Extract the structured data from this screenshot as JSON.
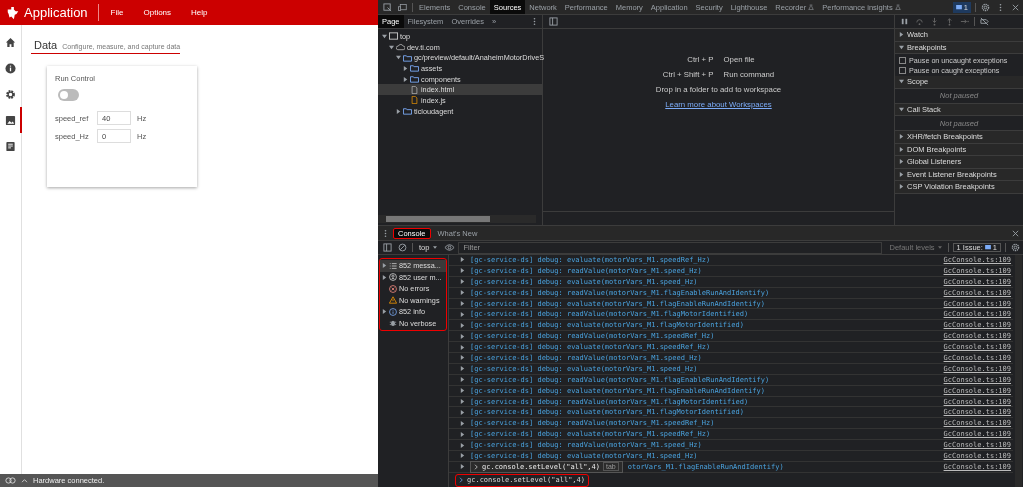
{
  "app": {
    "title": "Application",
    "menu": [
      "File",
      "Options",
      "Help"
    ],
    "nav": [
      {
        "kind": "home",
        "selected": false
      },
      {
        "kind": "info",
        "selected": false
      },
      {
        "kind": "settings",
        "selected": false
      },
      {
        "kind": "image",
        "selected": true
      },
      {
        "kind": "document",
        "selected": false
      }
    ],
    "page_title": "Data",
    "page_subtitle": "Configure, measure, and capture data",
    "card": {
      "title": "Run Control",
      "toggle_on": false,
      "fields": [
        {
          "label": "speed_ref",
          "value": "40",
          "unit": "Hz"
        },
        {
          "label": "speed_Hz",
          "value": "0",
          "unit": "Hz"
        }
      ]
    },
    "status": "Hardware connected."
  },
  "devtools": {
    "tabs": [
      {
        "label": "Elements",
        "selected": false,
        "experimental": false
      },
      {
        "label": "Console",
        "selected": false,
        "experimental": false
      },
      {
        "label": "Sources",
        "selected": true,
        "experimental": false
      },
      {
        "label": "Network",
        "selected": false,
        "experimental": false
      },
      {
        "label": "Performance",
        "selected": false,
        "experimental": false
      },
      {
        "label": "Memory",
        "selected": false,
        "experimental": false
      },
      {
        "label": "Application",
        "selected": false,
        "experimental": false
      },
      {
        "label": "Security",
        "selected": false,
        "experimental": false
      },
      {
        "label": "Lighthouse",
        "selected": false,
        "experimental": false
      },
      {
        "label": "Recorder",
        "selected": false,
        "experimental": true
      },
      {
        "label": "Performance insights",
        "selected": false,
        "experimental": true
      }
    ],
    "issues_count": "1",
    "navigator_tabs": [
      {
        "label": "Page",
        "selected": true
      },
      {
        "label": "Filesystem",
        "selected": false
      },
      {
        "label": "Overrides",
        "selected": false
      }
    ],
    "more_tabs": "»",
    "tree": [
      {
        "label": "top",
        "kind": "frame",
        "expanded": true,
        "selected": false,
        "children": [
          {
            "label": "dev.ti.com",
            "kind": "cloud",
            "expanded": true,
            "selected": false,
            "children": [
              {
                "label": "gc/preview/default/AnaheimMotorDriveS",
                "kind": "folder",
                "expanded": true,
                "selected": false,
                "children": [
                  {
                    "label": "assets",
                    "kind": "folder",
                    "expanded": false,
                    "selected": false
                  },
                  {
                    "label": "components",
                    "kind": "folder",
                    "expanded": false,
                    "selected": false
                  },
                  {
                    "label": "index.html",
                    "kind": "file",
                    "selected": true
                  },
                  {
                    "label": "index.js",
                    "kind": "script",
                    "selected": false
                  }
                ]
              },
              {
                "label": "ticloudagent",
                "kind": "folder",
                "expanded": false,
                "selected": false
              }
            ]
          }
        ]
      }
    ],
    "shortcuts": [
      {
        "keys": "Ctrl + P",
        "action": "Open file"
      },
      {
        "keys": "Ctrl + Shift + P",
        "action": "Run command"
      }
    ],
    "drop_hint": "Drop in a folder to add to workspace",
    "learn_link": "Learn more about Workspaces",
    "debugger": [
      {
        "label": "Watch",
        "expanded": false
      },
      {
        "label": "Breakpoints",
        "expanded": true,
        "checkboxes": [
          {
            "label": "Pause on uncaught exceptions",
            "checked": false
          },
          {
            "label": "Pause on caught exceptions",
            "checked": false
          }
        ]
      },
      {
        "label": "Scope",
        "expanded": true,
        "note": "Not paused"
      },
      {
        "label": "Call Stack",
        "expanded": true,
        "note": "Not paused"
      },
      {
        "label": "XHR/fetch Breakpoints",
        "expanded": false
      },
      {
        "label": "DOM Breakpoints",
        "expanded": false
      },
      {
        "label": "Global Listeners",
        "expanded": false
      },
      {
        "label": "Event Listener Breakpoints",
        "expanded": false
      },
      {
        "label": "CSP Violation Breakpoints",
        "expanded": false
      }
    ],
    "drawer": {
      "tabs": [
        {
          "label": "Console",
          "selected": true,
          "highlighted": true
        },
        {
          "label": "What's New",
          "selected": false,
          "highlighted": false
        }
      ],
      "context": "top",
      "filter_placeholder": "Filter",
      "levels": "Default levels",
      "issues_label": "1 Issue:",
      "issues_count": "1",
      "sidebar": {
        "highlighted": true,
        "items": [
          {
            "label": "852 messa...",
            "kind": "list",
            "expandable": true,
            "selected": true
          },
          {
            "label": "852 user m...",
            "kind": "user",
            "expandable": true,
            "selected": false
          },
          {
            "label": "No errors",
            "kind": "error",
            "expandable": false,
            "selected": false
          },
          {
            "label": "No warnings",
            "kind": "warning",
            "expandable": false,
            "selected": false
          },
          {
            "label": "852 info",
            "kind": "info",
            "expandable": true,
            "selected": false
          },
          {
            "label": "No verbose",
            "kind": "verbose",
            "expandable": false,
            "selected": false
          }
        ]
      },
      "logs": [
        {
          "text": "[gc-service-ds] debug: evaluate(motorVars_M1.speedRef_Hz)",
          "link": "GcConsole.ts:109",
          "covered": false
        },
        {
          "text": "[gc-service-ds] debug: readValue(motorVars_M1.speed_Hz)",
          "link": "GcConsole.ts:109",
          "covered": false
        },
        {
          "text": "[gc-service-ds] debug: evaluate(motorVars_M1.speed_Hz)",
          "link": "GcConsole.ts:109",
          "covered": false
        },
        {
          "text": "[gc-service-ds] debug: readValue(motorVars_M1.flagEnableRunAndIdentify)",
          "link": "GcConsole.ts:109",
          "covered": false
        },
        {
          "text": "[gc-service-ds] debug: evaluate(motorVars_M1.flagEnableRunAndIdentify)",
          "link": "GcConsole.ts:109",
          "covered": false
        },
        {
          "text": "[gc-service-ds] debug: readValue(motorVars_M1.flagMotorIdentified)",
          "link": "GcConsole.ts:109",
          "covered": false
        },
        {
          "text": "[gc-service-ds] debug: evaluate(motorVars_M1.flagMotorIdentified)",
          "link": "GcConsole.ts:109",
          "covered": false
        },
        {
          "text": "[gc-service-ds] debug: readValue(motorVars_M1.speedRef_Hz)",
          "link": "GcConsole.ts:109",
          "covered": false
        },
        {
          "text": "[gc-service-ds] debug: evaluate(motorVars_M1.speedRef_Hz)",
          "link": "GcConsole.ts:109",
          "covered": false
        },
        {
          "text": "[gc-service-ds] debug: readValue(motorVars_M1.speed_Hz)",
          "link": "GcConsole.ts:109",
          "covered": false
        },
        {
          "text": "[gc-service-ds] debug: evaluate(motorVars_M1.speed_Hz)",
          "link": "GcConsole.ts:109",
          "covered": false
        },
        {
          "text": "[gc-service-ds] debug: readValue(motorVars_M1.flagEnableRunAndIdentify)",
          "link": "GcConsole.ts:109",
          "covered": false
        },
        {
          "text": "[gc-service-ds] debug: evaluate(motorVars_M1.flagEnableRunAndIdentify)",
          "link": "GcConsole.ts:109",
          "covered": false
        },
        {
          "text": "[gc-service-ds] debug: readValue(motorVars_M1.flagMotorIdentified)",
          "link": "GcConsole.ts:109",
          "covered": false
        },
        {
          "text": "[gc-service-ds] debug: evaluate(motorVars_M1.flagMotorIdentified)",
          "link": "GcConsole.ts:109",
          "covered": false
        },
        {
          "text": "[gc-service-ds] debug: readValue(motorVars_M1.speedRef_Hz)",
          "link": "GcConsole.ts:109",
          "covered": false
        },
        {
          "text": "[gc-service-ds] debug: evaluate(motorVars_M1.speedRef_Hz)",
          "link": "GcConsole.ts:109",
          "covered": false
        },
        {
          "text": "[gc-service-ds] debug: readValue(motorVars_M1.speed_Hz)",
          "link": "GcConsole.ts:109",
          "covered": false
        },
        {
          "text": "[gc-service-ds] debug: evaluate(motorVars_M1.speed_Hz)",
          "link": "GcConsole.ts:109",
          "covered": false
        },
        {
          "text": "otorVars_M1.flagEnableRunAndIdentify)",
          "link": "GcConsole.ts:109",
          "covered": true
        }
      ],
      "autocomplete": {
        "text": "gc.console.setLevel(\"all\",4)",
        "hint": "tab"
      },
      "input": {
        "value": "gc.console.setLevel(\"all\",4)",
        "highlighted": true
      }
    }
  }
}
